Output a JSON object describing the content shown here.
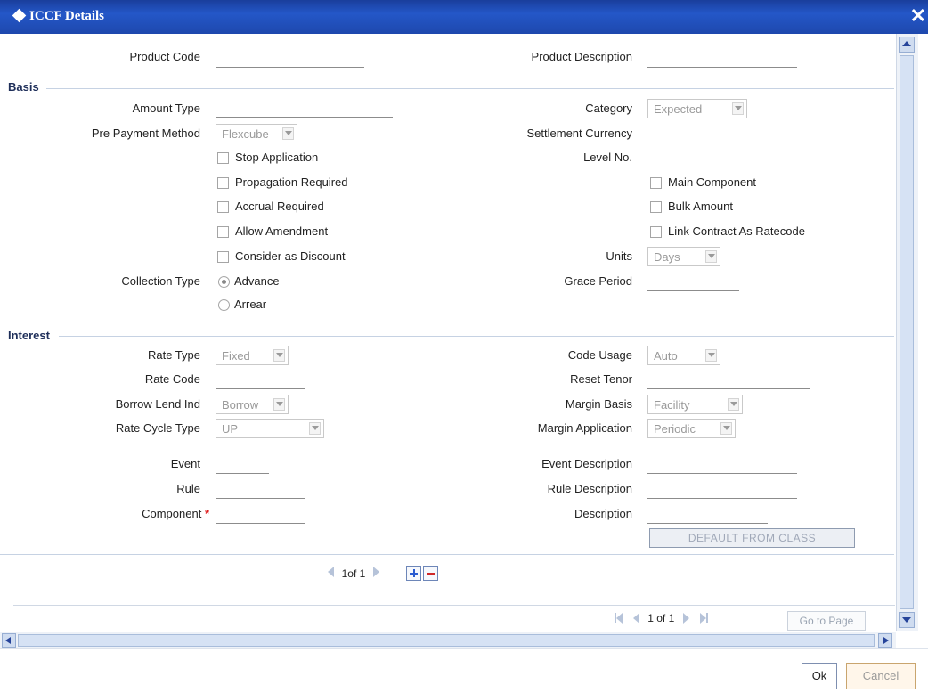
{
  "window": {
    "title": "ICCF Details"
  },
  "header": {
    "product_code": "Product Code",
    "product_description": "Product Description"
  },
  "basis": {
    "section": "Basis",
    "amount_type": "Amount Type",
    "pre_payment_method": "Pre Payment Method",
    "pre_payment_method_value": "Flexcube",
    "stop_application": "Stop Application",
    "propagation_required": "Propagation Required",
    "accrual_required": "Accrual Required",
    "allow_amendment": "Allow Amendment",
    "consider_as_discount": "Consider as Discount",
    "collection_type": "Collection Type",
    "advance": "Advance",
    "arrear": "Arrear",
    "category": "Category",
    "category_value": "Expected",
    "settlement_currency": "Settlement Currency",
    "level_no": "Level No.",
    "main_component": "Main Component",
    "bulk_amount": "Bulk Amount",
    "link_contract_as_ratecode": "Link Contract As Ratecode",
    "units": "Units",
    "units_value": "Days",
    "grace_period": "Grace Period"
  },
  "interest": {
    "section": "Interest",
    "rate_type": "Rate Type",
    "rate_type_value": "Fixed",
    "rate_code": "Rate Code",
    "borrow_lend_ind": "Borrow Lend Ind",
    "borrow_lend_value": "Borrow",
    "rate_cycle_type": "Rate Cycle Type",
    "rate_cycle_value": "UP",
    "code_usage": "Code Usage",
    "code_usage_value": "Auto",
    "reset_tenor": "Reset Tenor",
    "margin_basis": "Margin Basis",
    "margin_basis_value": "Facility",
    "margin_application": "Margin Application",
    "margin_application_value": "Periodic"
  },
  "event": {
    "event": "Event",
    "rule": "Rule",
    "component": "Component",
    "required_mark": "*",
    "event_description": "Event Description",
    "rule_description": "Rule Description",
    "description": "Description",
    "default_from_class": "DEFAULT FROM CLASS"
  },
  "pager_inner": {
    "text": "1of 1"
  },
  "pager_outer": {
    "text": "1 of 1",
    "goto": "Go to Page"
  },
  "footer": {
    "ok": "Ok",
    "cancel": "Cancel"
  }
}
